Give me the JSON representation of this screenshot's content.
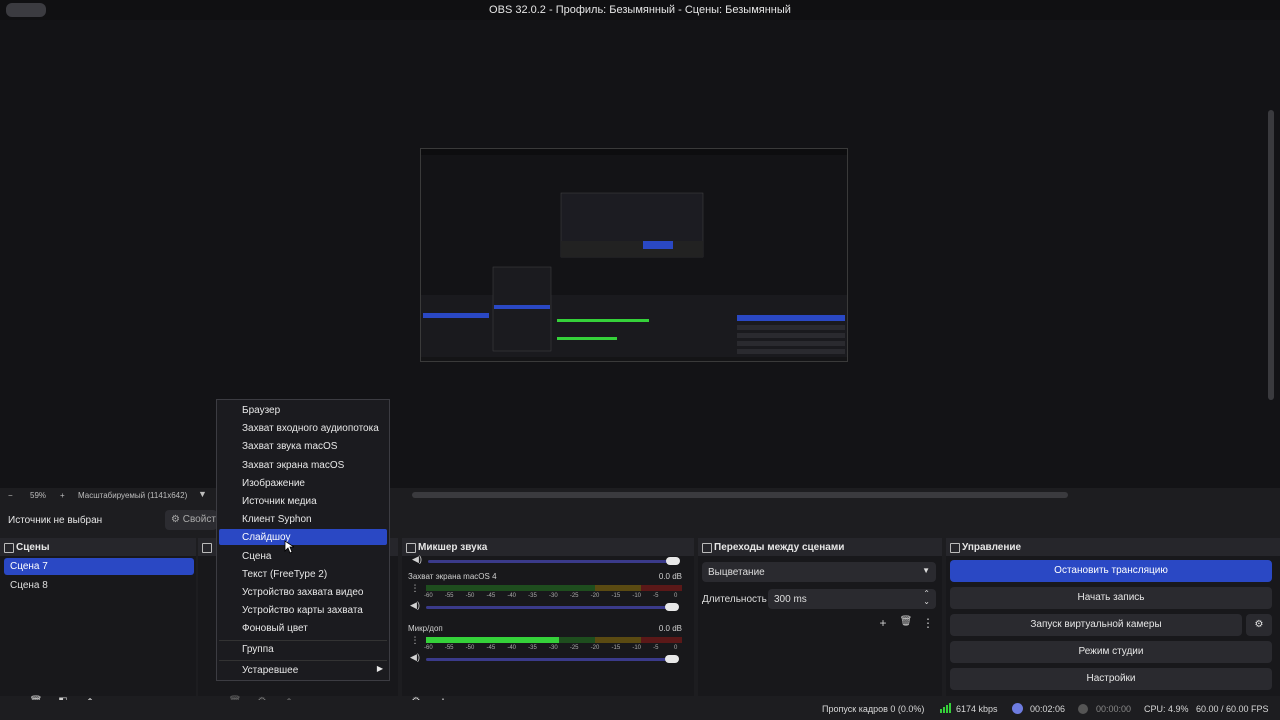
{
  "window": {
    "title": "OBS 32.0.2 - Профиль: Безымянный - Сцены: Безымянный"
  },
  "zoom": {
    "minus": "−",
    "value": "59%",
    "plus": "+",
    "mode": "Масштабируемый (1141x642)"
  },
  "source_bar": {
    "no_source": "Источник не выбран",
    "properties": "Свойст"
  },
  "scenes": {
    "title": "Сцены",
    "items": [
      {
        "label": "Сцена 7",
        "selected": true
      },
      {
        "label": "Сцена 8",
        "selected": false
      }
    ]
  },
  "add_source_menu": {
    "items": [
      "Браузер",
      "Захват входного аудиопотока",
      "Захват звука macOS",
      "Захват экрана macOS",
      "Изображение",
      "Источник медиа",
      "Клиент Syphon",
      "Слайдшоу",
      "Сцена",
      "Текст (FreeType 2)",
      "Устройство захвата видео",
      "Устройство карты захвата",
      "Фоновый цвет"
    ],
    "highlighted": "Слайдшоу",
    "group": "Группа",
    "deprecated": "Устаревшее"
  },
  "mixer": {
    "title": "Микшер звука",
    "channels": [
      {
        "name": "Захват экрана macOS 4",
        "db": "0.0 dB",
        "level": 0.0,
        "volume": 1.0
      },
      {
        "name": "Микр/доп",
        "db": "0.0 dB",
        "level": 0.52,
        "volume": 1.0
      }
    ],
    "scale": [
      "-60",
      "-55",
      "-50",
      "-45",
      "-40",
      "-35",
      "-30",
      "-25",
      "-20",
      "-15",
      "-10",
      "-5",
      "0"
    ]
  },
  "transitions": {
    "title": "Переходы между сценами",
    "selected": "Выцветание",
    "duration_label": "Длительность",
    "duration_value": "300 ms"
  },
  "controls": {
    "title": "Управление",
    "stop_stream": "Остановить трансляцию",
    "start_record": "Начать запись",
    "virtual_cam": "Запуск виртуальной камеры",
    "studio_mode": "Режим студии",
    "settings": "Настройки"
  },
  "status": {
    "dropped": "Пропуск кадров 0 (0.0%)",
    "bitrate": "6174 kbps",
    "stream_time": "00:02:06",
    "record_time": "00:00:00",
    "cpu": "CPU: 4.9%",
    "fps": "60.00 / 60.00 FPS"
  },
  "colors": {
    "accent": "#2a48c4",
    "meter_green": "#35d13a",
    "background": "#1d1d20"
  }
}
